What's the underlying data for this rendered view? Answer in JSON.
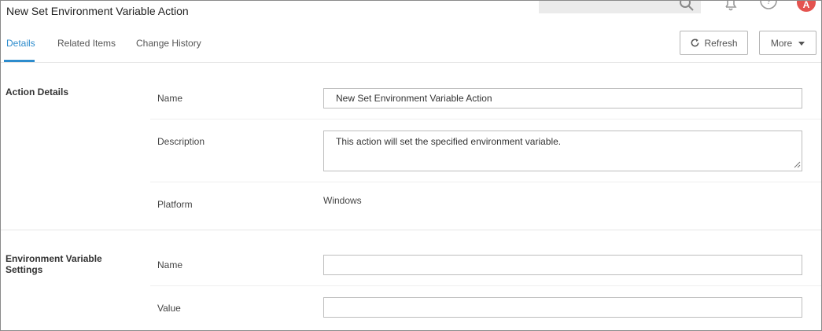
{
  "header": {
    "title": "New Set Environment Variable Action",
    "avatar_initial": "A"
  },
  "tabs": [
    {
      "label": "Details",
      "active": true
    },
    {
      "label": "Related Items",
      "active": false
    },
    {
      "label": "Change History",
      "active": false
    }
  ],
  "toolbar": {
    "refresh_label": "Refresh",
    "more_label": "More"
  },
  "action_details": {
    "section_title": "Action Details",
    "name_label": "Name",
    "name_value": "New Set Environment Variable Action",
    "description_label": "Description",
    "description_value": "This action will set the specified environment variable.",
    "platform_label": "Platform",
    "platform_value": "Windows"
  },
  "env_settings": {
    "section_title_line1": "Environment Variable",
    "section_title_line2": "Settings",
    "name_label": "Name",
    "name_value": "",
    "value_label": "Value",
    "value_value": ""
  },
  "colors": {
    "accent": "#2d8ccd",
    "avatar": "#e4534f"
  }
}
